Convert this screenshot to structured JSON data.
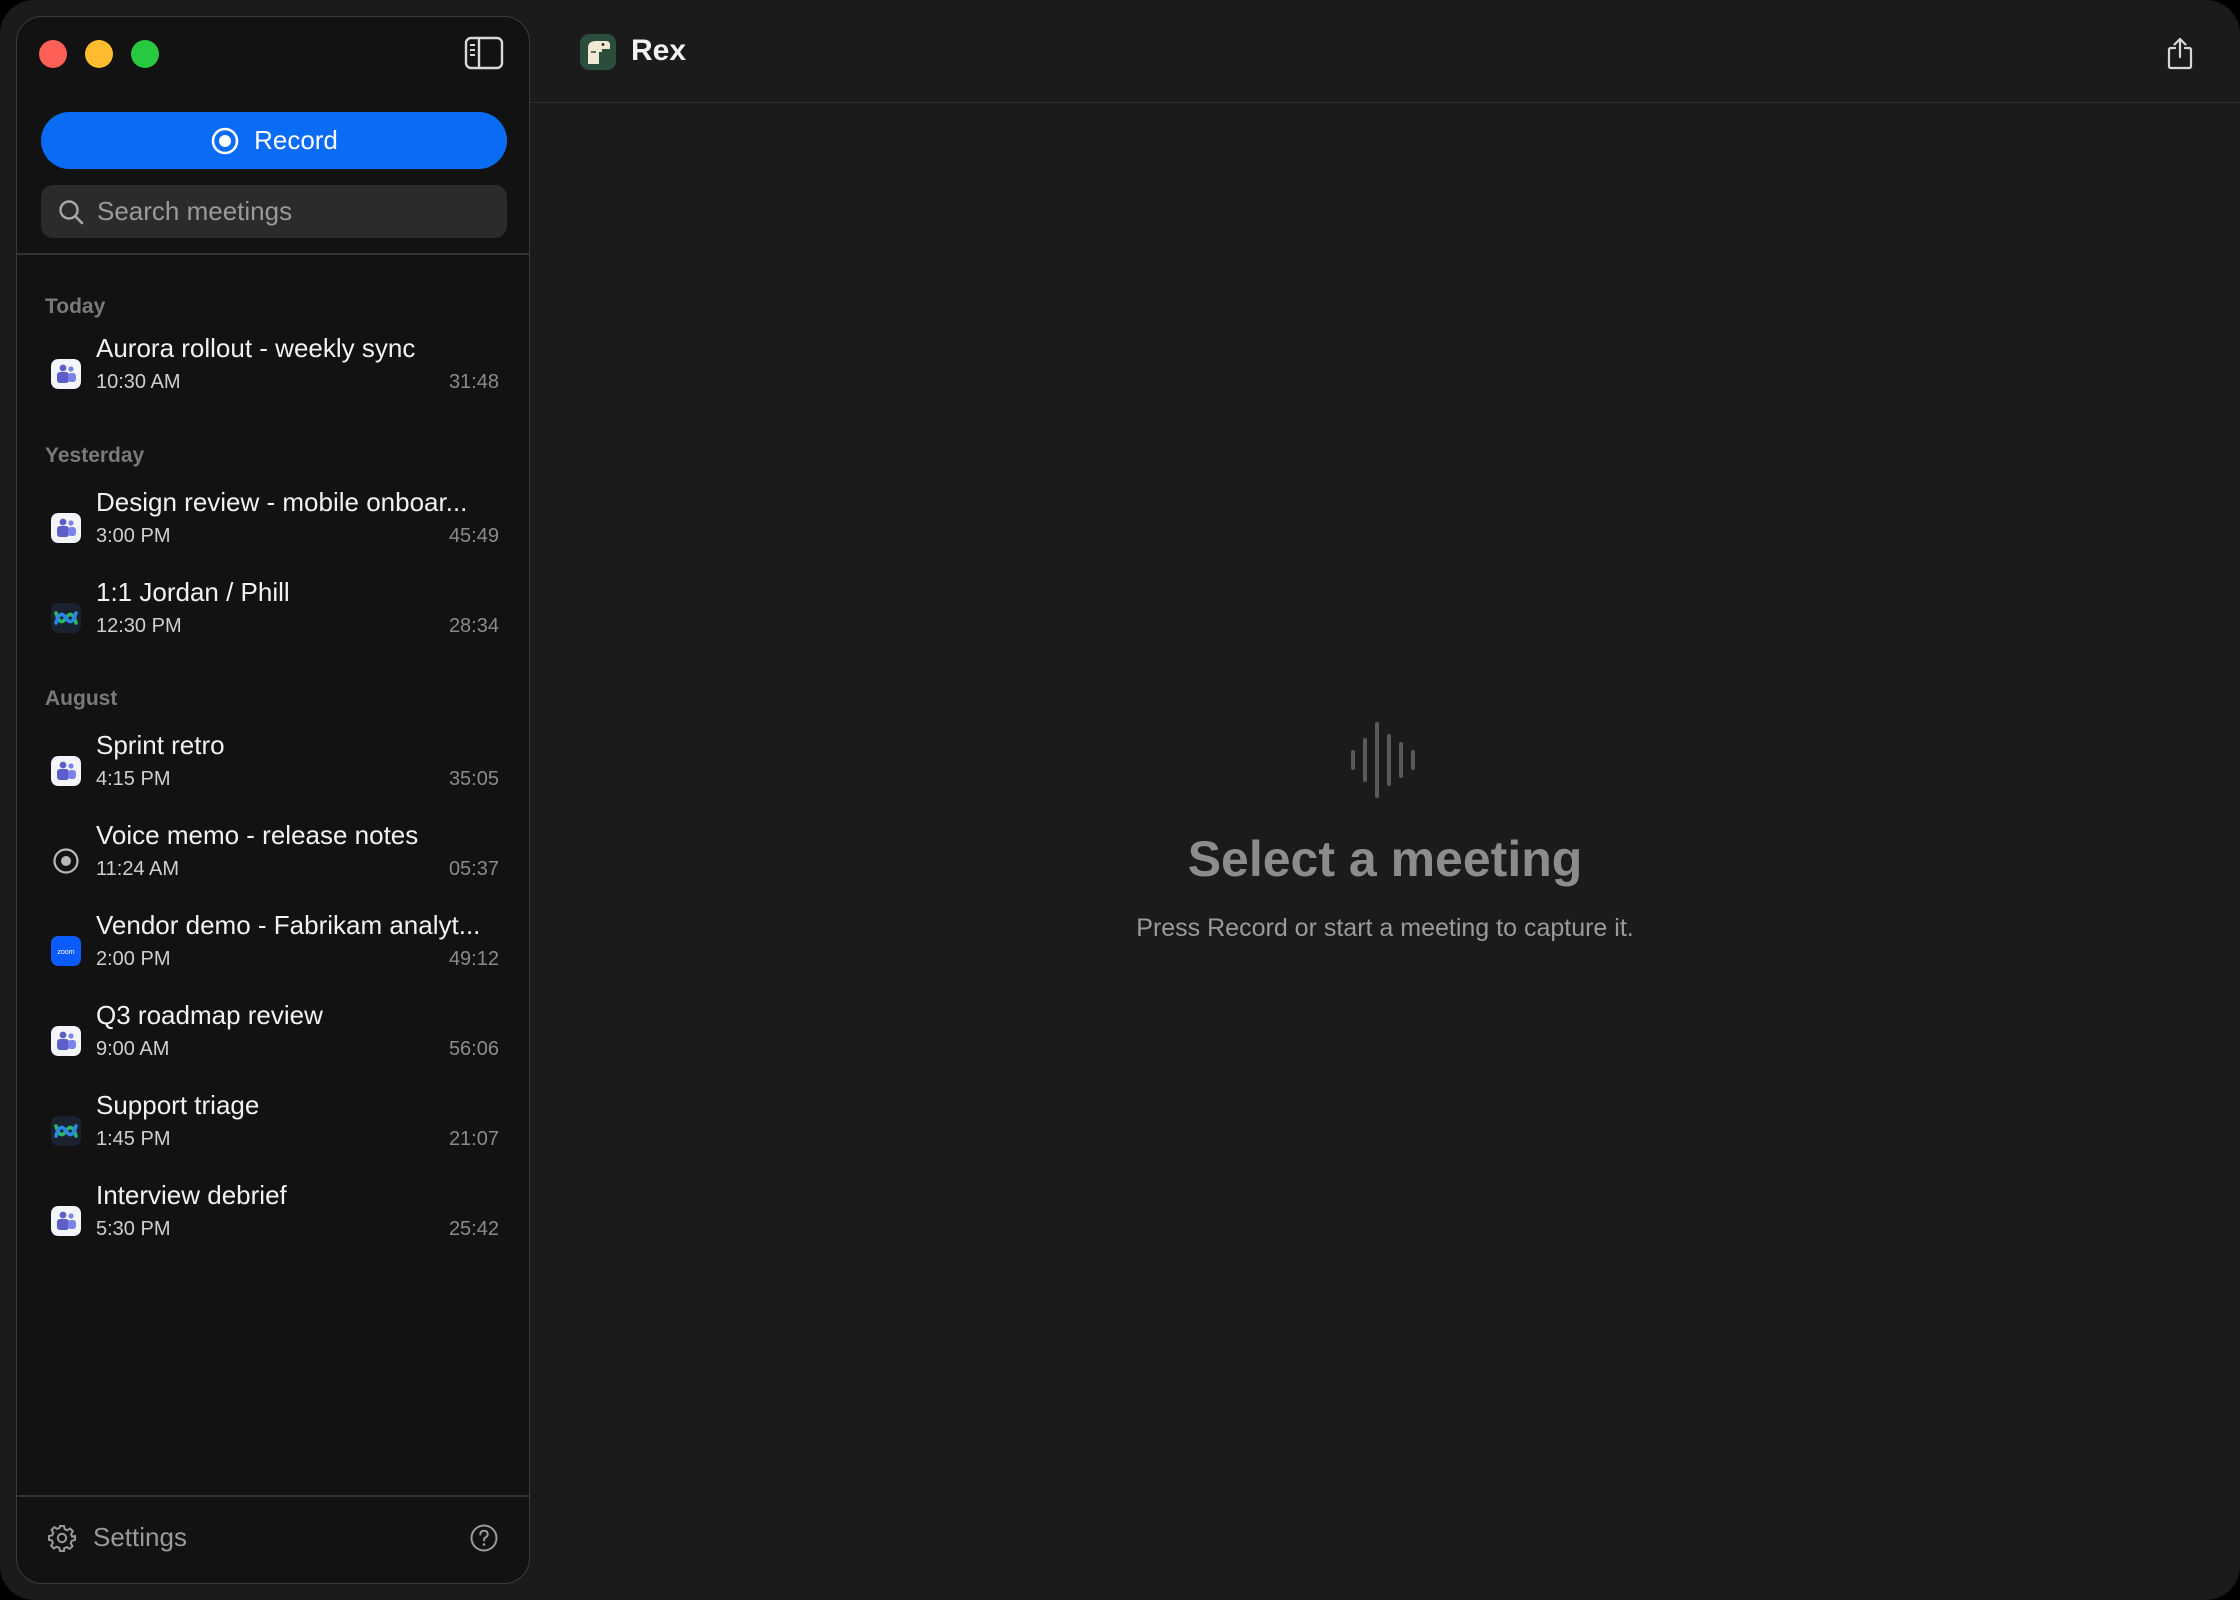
{
  "window": {
    "traffic_lights": {
      "close": "#fe5f57",
      "minimize": "#febc2e",
      "maximize": "#28c840"
    }
  },
  "sidebar": {
    "record_label": "Record",
    "search_placeholder": "Search meetings",
    "groups": [
      {
        "label": "Today",
        "items": [
          {
            "title": "Aurora rollout - weekly sync",
            "time": "10:30 AM",
            "duration": "31:48",
            "app": "teams-icon"
          }
        ]
      },
      {
        "label": "Yesterday",
        "items": [
          {
            "title": "Design review - mobile onboar...",
            "time": "3:00 PM",
            "duration": "45:49",
            "app": "teams-icon"
          },
          {
            "title": "1:1 Jordan / Phill",
            "time": "12:30 PM",
            "duration": "28:34",
            "app": "webex-icon"
          }
        ]
      },
      {
        "label": "August",
        "items": [
          {
            "title": "Sprint retro",
            "time": "4:15 PM",
            "duration": "35:05",
            "app": "teams-icon"
          },
          {
            "title": "Voice memo - release notes",
            "time": "11:24 AM",
            "duration": "05:37",
            "app": "record-icon"
          },
          {
            "title": "Vendor demo - Fabrikam analyt...",
            "time": "2:00 PM",
            "duration": "49:12",
            "app": "zoom-icon"
          },
          {
            "title": "Q3 roadmap review",
            "time": "9:00 AM",
            "duration": "56:06",
            "app": "teams-icon"
          },
          {
            "title": "Support triage",
            "time": "1:45 PM",
            "duration": "21:07",
            "app": "webex-icon"
          },
          {
            "title": "Interview debrief",
            "time": "5:30 PM",
            "duration": "25:42",
            "app": "teams-icon"
          }
        ]
      }
    ],
    "settings_label": "Settings",
    "zoom_icon_text": "zoom"
  },
  "main": {
    "app_title": "Rex",
    "empty_title": "Select a meeting",
    "empty_subtitle": "Press Record or start a meeting to capture it."
  },
  "colors": {
    "accent": "#0a6cf5",
    "window_bg": "#1b1b1b",
    "sidebar_bg": "#121212"
  }
}
